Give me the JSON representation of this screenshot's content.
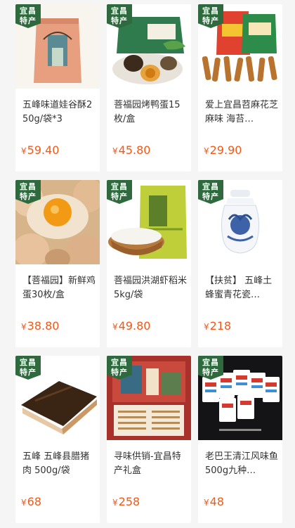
{
  "badge": {
    "line1": "宜昌",
    "line2": "特产"
  },
  "currency": "¥",
  "products": [
    {
      "title": "五峰味道娃谷酥250g/袋*3",
      "price": "59.40",
      "image": "bag-of-pastry"
    },
    {
      "title": "菩福园烤鸭蛋15枚/盒",
      "price": "45.80",
      "image": "roast-duck-eggs"
    },
    {
      "title": "爱上宜昌苕麻花芝麻味 海苔…",
      "price": "29.90",
      "image": "twisted-dough-snacks"
    },
    {
      "title": "【菩福园】新鲜鸡蛋30枚/盒",
      "price": "38.80",
      "image": "fresh-eggs"
    },
    {
      "title": "菩福园洪湖虾稻米5kg/袋",
      "price": "49.80",
      "image": "rice-bag"
    },
    {
      "title": "【扶贫】 五峰土蜂蜜青花瓷…",
      "price": "218",
      "image": "blue-white-porcelain-jar"
    },
    {
      "title": "五峰 五峰县腊猪肉 500g/袋",
      "price": "68",
      "image": "cured-pork"
    },
    {
      "title": "寻味供销-宜昌特产礼盒",
      "price": "258",
      "image": "gift-box"
    },
    {
      "title": "老巴王清江风味鱼500g九种…",
      "price": "48",
      "image": "fish-snack-packs"
    }
  ]
}
